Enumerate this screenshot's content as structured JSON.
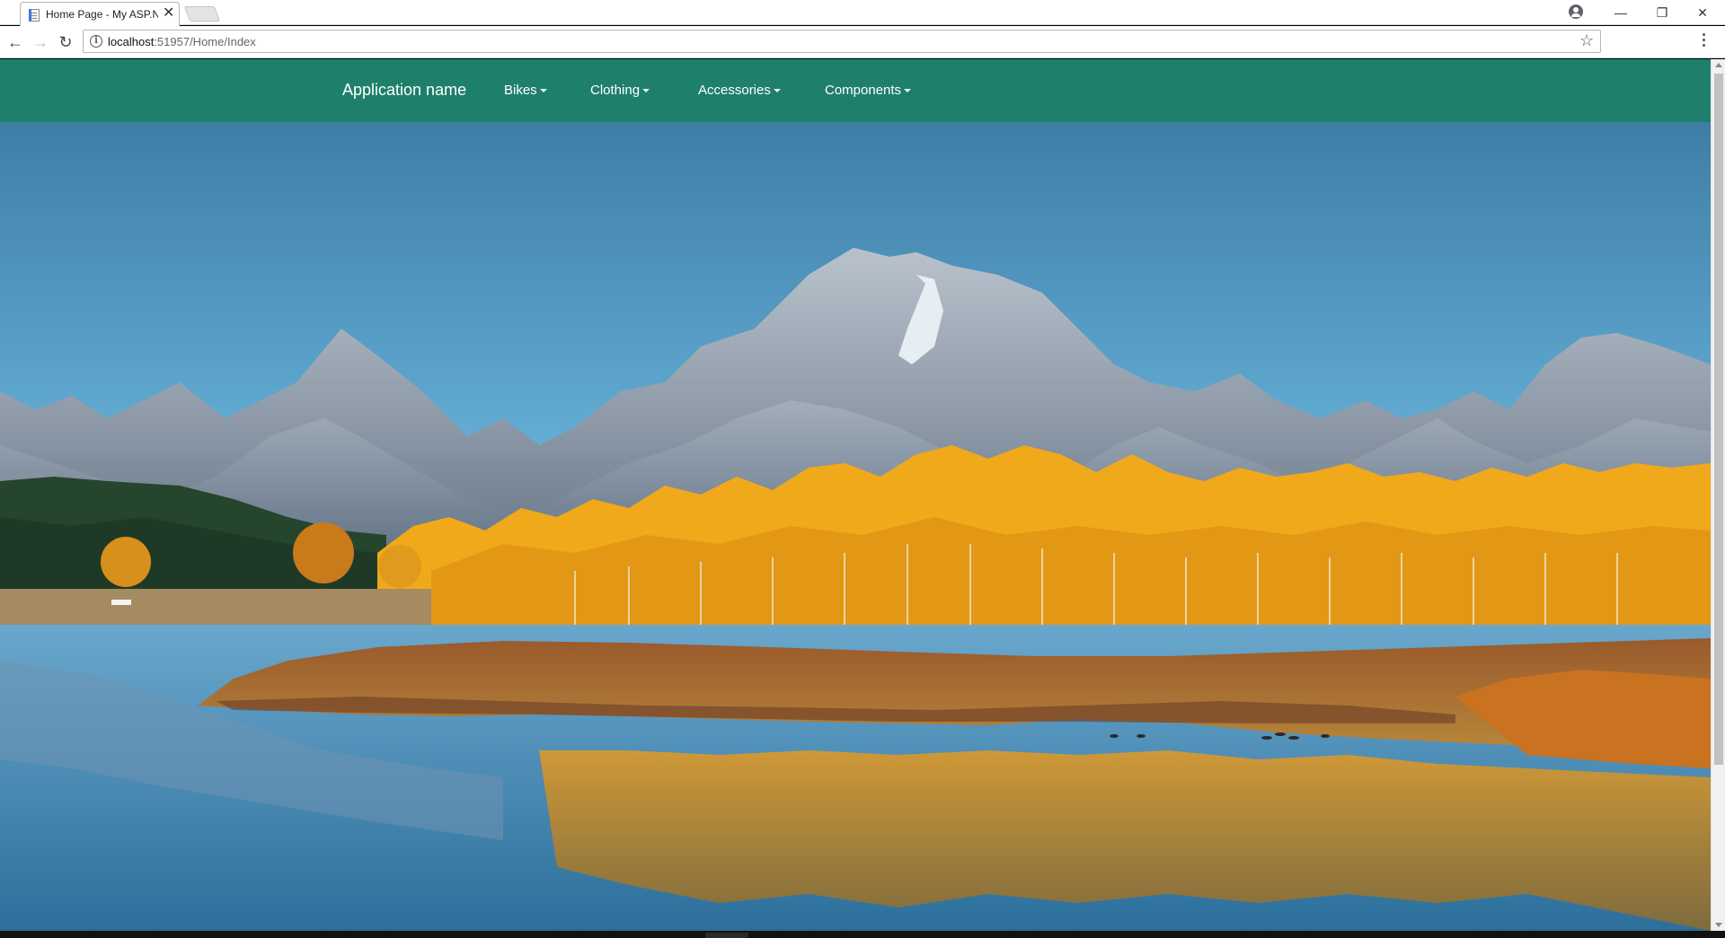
{
  "browser": {
    "tab_title": "Home Page - My ASP.NE",
    "tab_close_glyph": "✕",
    "url_host": "localhost",
    "url_path": ":51957/Home/Index",
    "back_glyph": "←",
    "forward_glyph": "→",
    "reload_glyph": "↻",
    "star_glyph": "☆",
    "info_glyph": "i",
    "minimize_glyph": "—",
    "restore_glyph": "❐",
    "close_glyph": "✕"
  },
  "navbar": {
    "brand": "Application name",
    "items": [
      {
        "label": "Bikes"
      },
      {
        "label": "Clothing"
      },
      {
        "label": "Accessories"
      },
      {
        "label": "Components"
      }
    ],
    "color": "#1e7f6c"
  },
  "hero": {
    "icon": "landscape-photo",
    "colors": {
      "sky_top": "#3e7ea6",
      "sky_bottom": "#7ec3e3",
      "mountain": "#8e9aa8",
      "foliage": "#f0a91a",
      "water": "#3f88b4"
    }
  }
}
